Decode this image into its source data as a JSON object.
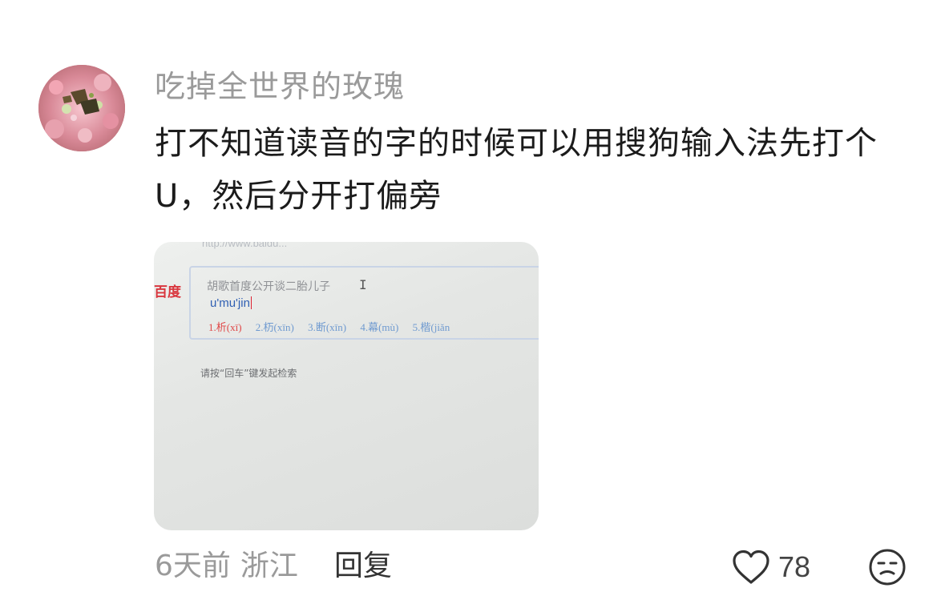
{
  "comment": {
    "username": "吃掉全世界的玫瑰",
    "text": "打不知道读音的字的时候可以用搜狗输入法先打个U，然后分开打偏旁",
    "time": "6天前",
    "location": "浙江",
    "reply_label": "回复",
    "like_count": "78",
    "icons": {
      "avatar": "avatar-image",
      "like": "heart-icon",
      "reaction": "emoji-icon"
    }
  },
  "attachment": {
    "top_url": "http://www.baidu...",
    "brand": "百度",
    "search_query": "胡歌首度公开谈二胎儿子",
    "ime_input": "u'mu'jin",
    "candidates": [
      "1.析(xī)",
      "2.杤(xīn)",
      "3.断(xīn)",
      "4.幕(mù)",
      "5.楷(jiǎn"
    ],
    "hint": "请按“回车”键发起检索"
  }
}
